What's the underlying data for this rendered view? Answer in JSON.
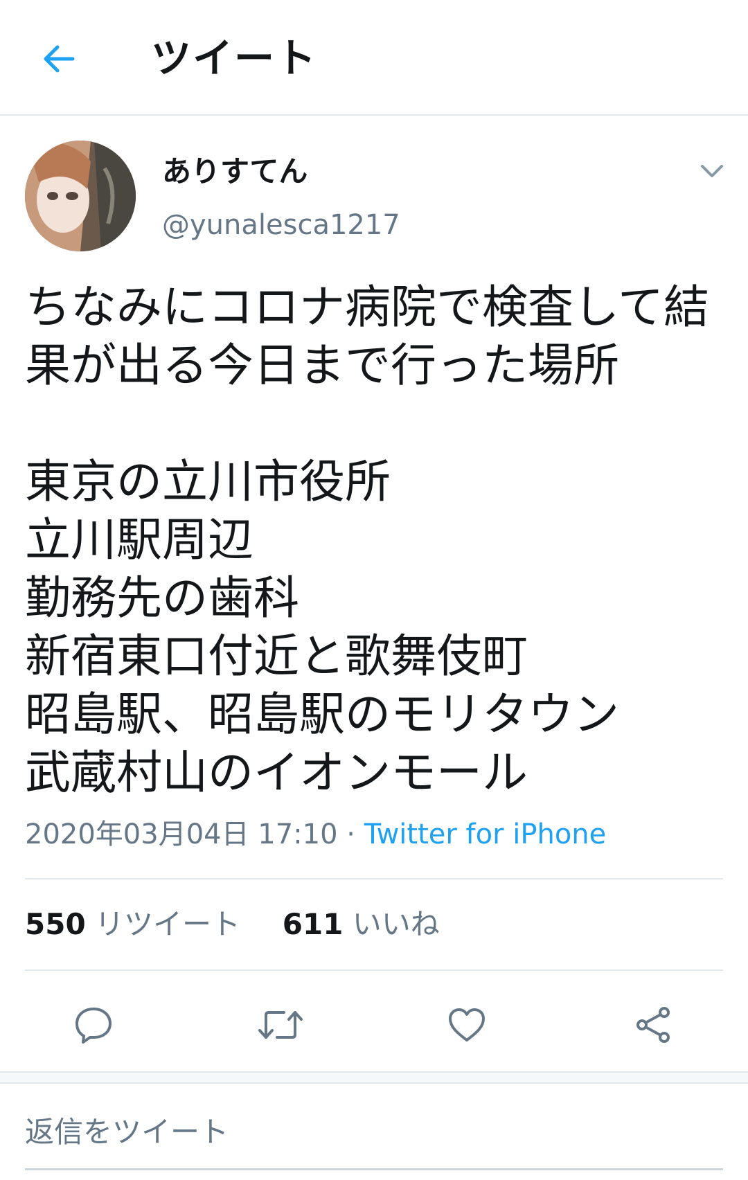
{
  "header": {
    "title": "ツイート"
  },
  "tweet": {
    "display_name": "ありすてん",
    "handle": "@yunalesca1217",
    "text_lines": [
      "ちなみにコロナ病院で検査して結",
      "果が出る今日まで行った場所",
      "",
      "東京の立川市役所",
      "立川駅周辺",
      "勤務先の歯科",
      "新宿東口付近と歌舞伎町",
      "昭島駅、昭島駅のモリタウン",
      "武蔵村山のイオンモール"
    ],
    "timestamp": "2020年03月04日 17:10",
    "separator": " · ",
    "source": "Twitter for iPhone"
  },
  "stats": {
    "retweets_count": "550",
    "retweets_label": "リツイート",
    "likes_count": "611",
    "likes_label": "いいね"
  },
  "reply": {
    "placeholder": "返信をツイート"
  },
  "colors": {
    "accent": "#1da1f2",
    "text": "#14171a",
    "secondary": "#657786",
    "icon": "#657786",
    "divider": "#e1e8ed"
  },
  "icons": {
    "back": "arrow-left-icon",
    "caret": "chevron-down-icon",
    "reply": "comment-icon",
    "retweet": "retweet-icon",
    "like": "heart-icon",
    "share": "share-icon"
  }
}
